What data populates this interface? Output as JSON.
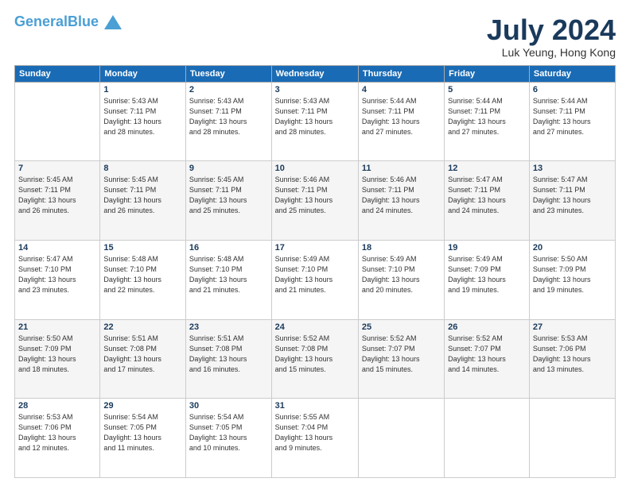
{
  "header": {
    "logo_line1": "General",
    "logo_line1_colored": "Blue",
    "title": "July 2024",
    "subtitle": "Luk Yeung, Hong Kong"
  },
  "weekdays": [
    "Sunday",
    "Monday",
    "Tuesday",
    "Wednesday",
    "Thursday",
    "Friday",
    "Saturday"
  ],
  "weeks": [
    [
      {
        "day": "",
        "info": ""
      },
      {
        "day": "1",
        "info": "Sunrise: 5:43 AM\nSunset: 7:11 PM\nDaylight: 13 hours\nand 28 minutes."
      },
      {
        "day": "2",
        "info": "Sunrise: 5:43 AM\nSunset: 7:11 PM\nDaylight: 13 hours\nand 28 minutes."
      },
      {
        "day": "3",
        "info": "Sunrise: 5:43 AM\nSunset: 7:11 PM\nDaylight: 13 hours\nand 28 minutes."
      },
      {
        "day": "4",
        "info": "Sunrise: 5:44 AM\nSunset: 7:11 PM\nDaylight: 13 hours\nand 27 minutes."
      },
      {
        "day": "5",
        "info": "Sunrise: 5:44 AM\nSunset: 7:11 PM\nDaylight: 13 hours\nand 27 minutes."
      },
      {
        "day": "6",
        "info": "Sunrise: 5:44 AM\nSunset: 7:11 PM\nDaylight: 13 hours\nand 27 minutes."
      }
    ],
    [
      {
        "day": "7",
        "info": "Sunrise: 5:45 AM\nSunset: 7:11 PM\nDaylight: 13 hours\nand 26 minutes."
      },
      {
        "day": "8",
        "info": "Sunrise: 5:45 AM\nSunset: 7:11 PM\nDaylight: 13 hours\nand 26 minutes."
      },
      {
        "day": "9",
        "info": "Sunrise: 5:45 AM\nSunset: 7:11 PM\nDaylight: 13 hours\nand 25 minutes."
      },
      {
        "day": "10",
        "info": "Sunrise: 5:46 AM\nSunset: 7:11 PM\nDaylight: 13 hours\nand 25 minutes."
      },
      {
        "day": "11",
        "info": "Sunrise: 5:46 AM\nSunset: 7:11 PM\nDaylight: 13 hours\nand 24 minutes."
      },
      {
        "day": "12",
        "info": "Sunrise: 5:47 AM\nSunset: 7:11 PM\nDaylight: 13 hours\nand 24 minutes."
      },
      {
        "day": "13",
        "info": "Sunrise: 5:47 AM\nSunset: 7:11 PM\nDaylight: 13 hours\nand 23 minutes."
      }
    ],
    [
      {
        "day": "14",
        "info": "Sunrise: 5:47 AM\nSunset: 7:10 PM\nDaylight: 13 hours\nand 23 minutes."
      },
      {
        "day": "15",
        "info": "Sunrise: 5:48 AM\nSunset: 7:10 PM\nDaylight: 13 hours\nand 22 minutes."
      },
      {
        "day": "16",
        "info": "Sunrise: 5:48 AM\nSunset: 7:10 PM\nDaylight: 13 hours\nand 21 minutes."
      },
      {
        "day": "17",
        "info": "Sunrise: 5:49 AM\nSunset: 7:10 PM\nDaylight: 13 hours\nand 21 minutes."
      },
      {
        "day": "18",
        "info": "Sunrise: 5:49 AM\nSunset: 7:10 PM\nDaylight: 13 hours\nand 20 minutes."
      },
      {
        "day": "19",
        "info": "Sunrise: 5:49 AM\nSunset: 7:09 PM\nDaylight: 13 hours\nand 19 minutes."
      },
      {
        "day": "20",
        "info": "Sunrise: 5:50 AM\nSunset: 7:09 PM\nDaylight: 13 hours\nand 19 minutes."
      }
    ],
    [
      {
        "day": "21",
        "info": "Sunrise: 5:50 AM\nSunset: 7:09 PM\nDaylight: 13 hours\nand 18 minutes."
      },
      {
        "day": "22",
        "info": "Sunrise: 5:51 AM\nSunset: 7:08 PM\nDaylight: 13 hours\nand 17 minutes."
      },
      {
        "day": "23",
        "info": "Sunrise: 5:51 AM\nSunset: 7:08 PM\nDaylight: 13 hours\nand 16 minutes."
      },
      {
        "day": "24",
        "info": "Sunrise: 5:52 AM\nSunset: 7:08 PM\nDaylight: 13 hours\nand 15 minutes."
      },
      {
        "day": "25",
        "info": "Sunrise: 5:52 AM\nSunset: 7:07 PM\nDaylight: 13 hours\nand 15 minutes."
      },
      {
        "day": "26",
        "info": "Sunrise: 5:52 AM\nSunset: 7:07 PM\nDaylight: 13 hours\nand 14 minutes."
      },
      {
        "day": "27",
        "info": "Sunrise: 5:53 AM\nSunset: 7:06 PM\nDaylight: 13 hours\nand 13 minutes."
      }
    ],
    [
      {
        "day": "28",
        "info": "Sunrise: 5:53 AM\nSunset: 7:06 PM\nDaylight: 13 hours\nand 12 minutes."
      },
      {
        "day": "29",
        "info": "Sunrise: 5:54 AM\nSunset: 7:05 PM\nDaylight: 13 hours\nand 11 minutes."
      },
      {
        "day": "30",
        "info": "Sunrise: 5:54 AM\nSunset: 7:05 PM\nDaylight: 13 hours\nand 10 minutes."
      },
      {
        "day": "31",
        "info": "Sunrise: 5:55 AM\nSunset: 7:04 PM\nDaylight: 13 hours\nand 9 minutes."
      },
      {
        "day": "",
        "info": ""
      },
      {
        "day": "",
        "info": ""
      },
      {
        "day": "",
        "info": ""
      }
    ]
  ]
}
